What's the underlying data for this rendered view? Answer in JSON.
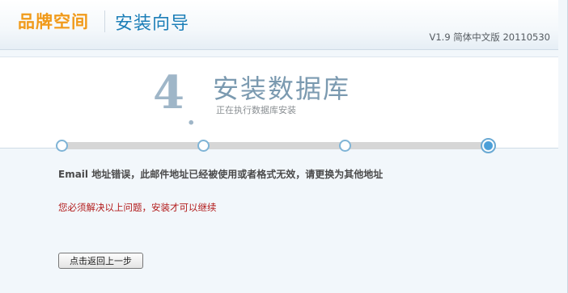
{
  "header": {
    "logo_text": "品牌空间",
    "wizard_title": "安装向导",
    "version": "V1.9 简体中文版 20110530"
  },
  "step": {
    "number": "4",
    "dot": ".",
    "title": "安装数据库",
    "subtitle": "正在执行数据库安装"
  },
  "progress": {
    "total_steps": 4,
    "current_step": 4
  },
  "messages": {
    "error": "Email 地址错误，此邮件地址已经被使用或者格式无效，请更换为其他地址",
    "warning": "您必须解决以上问题，安装才可以继续"
  },
  "actions": {
    "back_label": "点击返回上一步"
  },
  "colors": {
    "logo": "#f09a1b",
    "wizard_title": "#1d7fb8",
    "step_title": "#7b9ab0",
    "warning": "#b21a1a"
  }
}
